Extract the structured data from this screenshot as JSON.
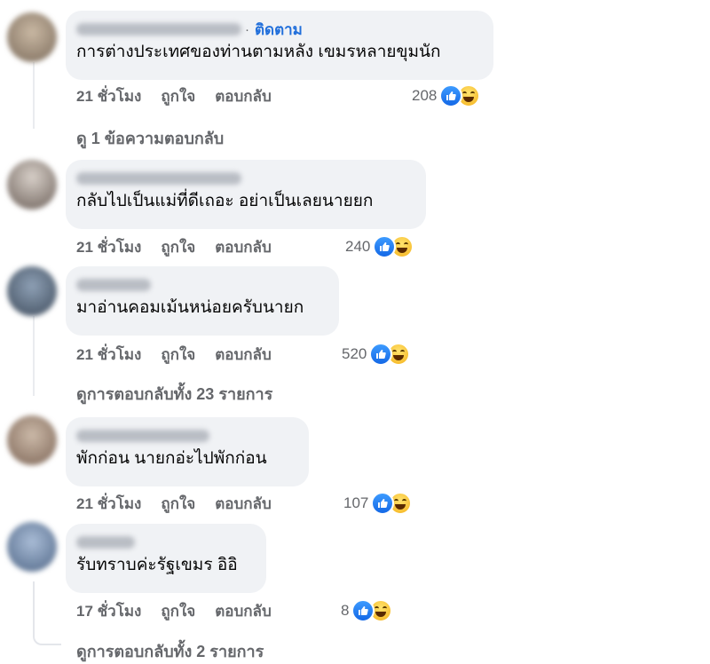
{
  "comments": [
    {
      "follow_label": "ติดตาม",
      "dot": "·",
      "text": "การต่างประเทศของท่านตามหลัง เขมรหลายขุมนัก",
      "time": "21 ชั่วโมง",
      "like": "ถูกใจ",
      "reply": "ตอบกลับ",
      "reactions": "208",
      "view_replies": "ดู 1 ข้อความตอบกลับ"
    },
    {
      "text": "กลับไปเป็นแม่ที่ดีเถอะ อย่าเป็นเลยนายยก",
      "time": "21 ชั่วโมง",
      "like": "ถูกใจ",
      "reply": "ตอบกลับ",
      "reactions": "240"
    },
    {
      "text": "มาอ่านคอมเม้นหน่อยครับนายก",
      "time": "21 ชั่วโมง",
      "like": "ถูกใจ",
      "reply": "ตอบกลับ",
      "reactions": "520",
      "view_replies": "ดูการตอบกลับทั้ง 23 รายการ"
    },
    {
      "text": "พักก่อน นายกอ่ะไปพักก่อน",
      "time": "21 ชั่วโมง",
      "like": "ถูกใจ",
      "reply": "ตอบกลับ",
      "reactions": "107"
    },
    {
      "text": "รับทราบค่ะรัฐเขมร อิอิ",
      "time": "17 ชั่วโมง",
      "like": "ถูกใจ",
      "reply": "ตอบกลับ",
      "reactions": "8",
      "view_replies": "ดูการตอบกลับทั้ง 2 รายการ"
    }
  ],
  "colors": {
    "link_blue": "#216fdb",
    "bubble_bg": "#f0f2f5",
    "meta_gray": "#65676b"
  },
  "icons": [
    "like-icon",
    "haha-icon",
    "avatar"
  ]
}
